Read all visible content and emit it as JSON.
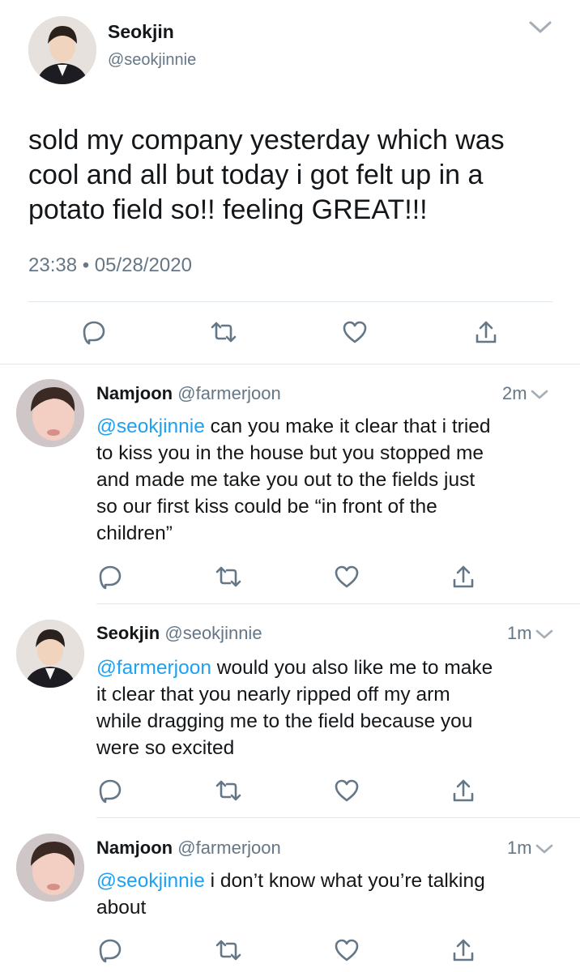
{
  "main_tweet": {
    "name": "Seokjin",
    "handle": "@seokjinnie",
    "lines": [
      "sold my company yesterday which was",
      "cool and all but today i got felt up in a",
      "potato field so!! feeling GREAT!!!"
    ],
    "timestamp": "23:38 • 05/28/2020"
  },
  "replies": [
    {
      "name": "Namjoon",
      "handle": "@farmerjoon",
      "time": "2m",
      "mention": "@seokjinnie",
      "first_line_rest": " can you make it clear that i tried",
      "lines": [
        "to kiss you in the house but you stopped me",
        "and made me take you out to the fields just",
        "so our first kiss could be “in front of the",
        "children”"
      ]
    },
    {
      "name": "Seokjin",
      "handle": "@seokjinnie",
      "time": "1m",
      "mention": "@farmerjoon",
      "first_line_rest": " would you also like me to make",
      "lines": [
        "it clear that you nearly ripped off my arm",
        "while dragging me to the field because you",
        "were so excited"
      ]
    },
    {
      "name": "Namjoon",
      "handle": "@farmerjoon",
      "time": "1m",
      "mention": "@seokjinnie",
      "first_line_rest": " i don’t know what you’re talking",
      "lines": [
        "about"
      ]
    }
  ],
  "icons": {
    "reply": "reply-bubble-icon",
    "retweet": "retweet-icon",
    "like": "heart-icon",
    "share": "share-icon",
    "menu": "chevron-down-icon"
  },
  "colors": {
    "mention": "#1da1f2",
    "secondary_text": "#657786",
    "divider": "#e1e8ed"
  }
}
